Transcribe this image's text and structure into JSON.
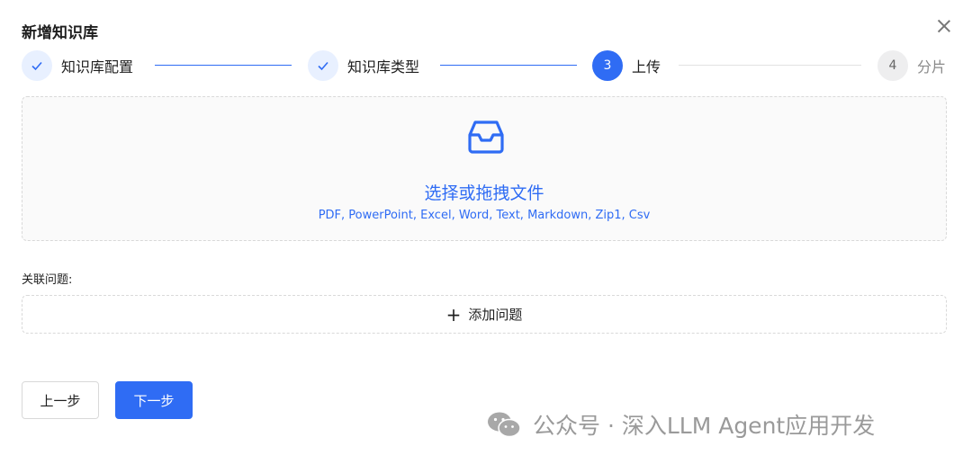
{
  "dialog": {
    "title": "新增知识库"
  },
  "steps": [
    {
      "number": "1",
      "label": "知识库配置",
      "status": "done"
    },
    {
      "number": "2",
      "label": "知识库类型",
      "status": "done"
    },
    {
      "number": "3",
      "label": "上传",
      "status": "active"
    },
    {
      "number": "4",
      "label": "分片",
      "status": "wait"
    }
  ],
  "upload": {
    "title": "选择或拖拽文件",
    "hint": "PDF, PowerPoint, Excel, Word, Text, Markdown, Zip1, Csv",
    "icon": "inbox-icon"
  },
  "questions": {
    "label": "关联问题:",
    "add_label": "添加问题"
  },
  "footer": {
    "prev_label": "上一步",
    "next_label": "下一步"
  },
  "watermark": {
    "text": "公众号 · 深入LLM Agent应用开发"
  },
  "colors": {
    "primary": "#2f6cf4",
    "done_bg": "#e8f0ff",
    "wait_bg": "#eeeeef",
    "border": "#d9d9d9"
  }
}
